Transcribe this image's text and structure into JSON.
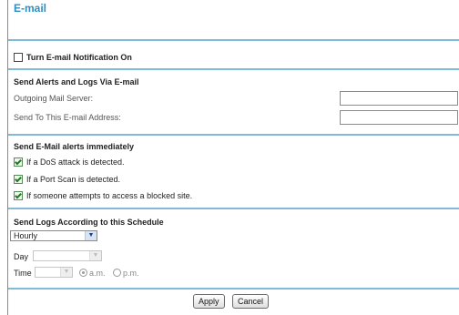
{
  "page": {
    "title": "E-mail"
  },
  "notify": {
    "checkbox_label": "Turn E-mail Notification On",
    "checked": false
  },
  "alerts_logs": {
    "heading": "Send Alerts and Logs Via E-mail",
    "outgoing_label": "Outgoing Mail Server:",
    "outgoing_value": "",
    "send_to_label": "Send To This E-mail Address:",
    "send_to_value": ""
  },
  "immediate": {
    "heading": "Send E-Mail alerts immediately",
    "items": [
      {
        "label": "If a DoS attack is detected.",
        "checked": true
      },
      {
        "label": "If a Port Scan is detected.",
        "checked": true
      },
      {
        "label": "If someone attempts to access a blocked site.",
        "checked": true
      }
    ]
  },
  "schedule": {
    "heading": "Send Logs According to this Schedule",
    "frequency_value": "Hourly",
    "day_label": "Day",
    "day_value": "",
    "time_label": "Time",
    "time_value": "",
    "am_label": "a.m.",
    "pm_label": "p.m.",
    "ampm_selected": "a.m."
  },
  "buttons": {
    "apply": "Apply",
    "cancel": "Cancel"
  }
}
